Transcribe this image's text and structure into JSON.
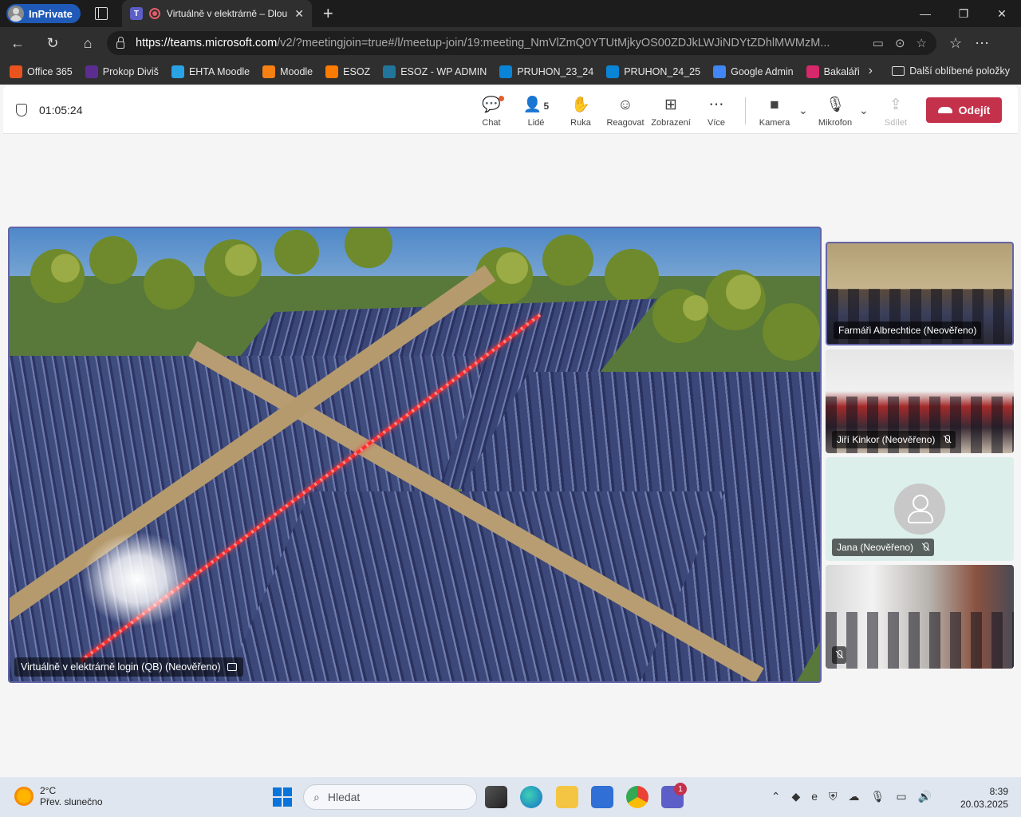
{
  "browser": {
    "inprivate_label": "InPrivate",
    "tab_title": "Virtuálně v elektrárně – Dlou",
    "url_host": "https://teams.microsoft.com",
    "url_path": "/v2/?meetingjoin=true#/l/meetup-join/19:meeting_NmVlZmQ0YTUtMjkyOS00ZDJkLWJiNDYtZDhlMWMzM...",
    "favorites": [
      {
        "label": "Office 365",
        "color": "#e9541e"
      },
      {
        "label": "Prokop Diviš",
        "color": "#5c2d91"
      },
      {
        "label": "EHTA Moodle",
        "color": "#29a3e6"
      },
      {
        "label": "Moodle",
        "color": "#f98012"
      },
      {
        "label": "ESOZ",
        "color": "#ff7a00"
      },
      {
        "label": "ESOZ - WP ADMIN",
        "color": "#21759b"
      },
      {
        "label": "PRUHON_23_24",
        "color": "#0a84d6"
      },
      {
        "label": "PRUHON_24_25",
        "color": "#0a84d6"
      },
      {
        "label": "Google Admin",
        "color": "#4285f4"
      },
      {
        "label": "Bakaláři",
        "color": "#d6286b"
      }
    ],
    "favorites_folder": "Další oblíbené položky"
  },
  "meeting": {
    "timer": "01:05:24",
    "toolbar": {
      "chat": "Chat",
      "people": "Lidé",
      "people_count": "5",
      "hand": "Ruka",
      "react": "Reagovat",
      "view": "Zobrazení",
      "more": "Více",
      "camera": "Kamera",
      "mic": "Mikrofon",
      "share": "Sdílet",
      "leave": "Odejít"
    },
    "main_video_name": "Virtuálně v elektrárně login (QB) (Neověřeno)",
    "participants": [
      {
        "name": "Farmáři Albrechtice (Neověřeno)",
        "muted": false
      },
      {
        "name": "Jiří Kinkor (Neověřeno)",
        "muted": true
      },
      {
        "name": "Jana (Neověřeno)",
        "muted": true
      },
      {
        "name": "",
        "muted": true
      }
    ]
  },
  "taskbar": {
    "temperature": "2°C",
    "weather": "Přev. slunečno",
    "search_placeholder": "Hledat",
    "time": "8:39",
    "date": "20.03.2025",
    "teams_badge": "1"
  }
}
